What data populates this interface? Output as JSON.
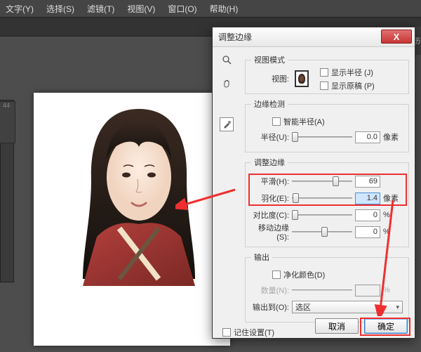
{
  "menu": {
    "text": "文字(Y)",
    "select": "选择(S)",
    "filter": "滤镜(T)",
    "view": "视图(V)",
    "window": "窗口(O)",
    "help": "帮助(H)"
  },
  "dialog": {
    "title": "调整边缘",
    "close": "X",
    "view_mode": {
      "legend": "视图模式",
      "view_label": "视图:",
      "show_radius": "显示半径 (J)",
      "show_original": "显示原稿 (P)"
    },
    "edge_detect": {
      "legend": "边缘检测",
      "smart_radius": "智能半径(A)",
      "radius_label": "半径(U):",
      "radius_value": "0.0",
      "radius_unit": "像素"
    },
    "adjust_edge": {
      "legend": "调整边缘",
      "smooth_label": "平滑(H):",
      "smooth_value": "69",
      "feather_label": "羽化(E):",
      "feather_value": "1.4",
      "feather_unit": "像素",
      "contrast_label": "对比度(C):",
      "contrast_value": "0",
      "contrast_unit": "%",
      "shift_label": "移动边缘(S):",
      "shift_value": "0",
      "shift_unit": "%"
    },
    "output": {
      "legend": "输出",
      "decontaminate": "净化颜色(D)",
      "amount_label": "数量(N):",
      "amount_value": "",
      "amount_unit": "%",
      "output_to_label": "输出到(O):",
      "output_to_value": "选区"
    },
    "remember": "记住设置(T)",
    "cancel": "取消",
    "ok": "确定"
  },
  "right_strip": "历",
  "left_badge": "44"
}
